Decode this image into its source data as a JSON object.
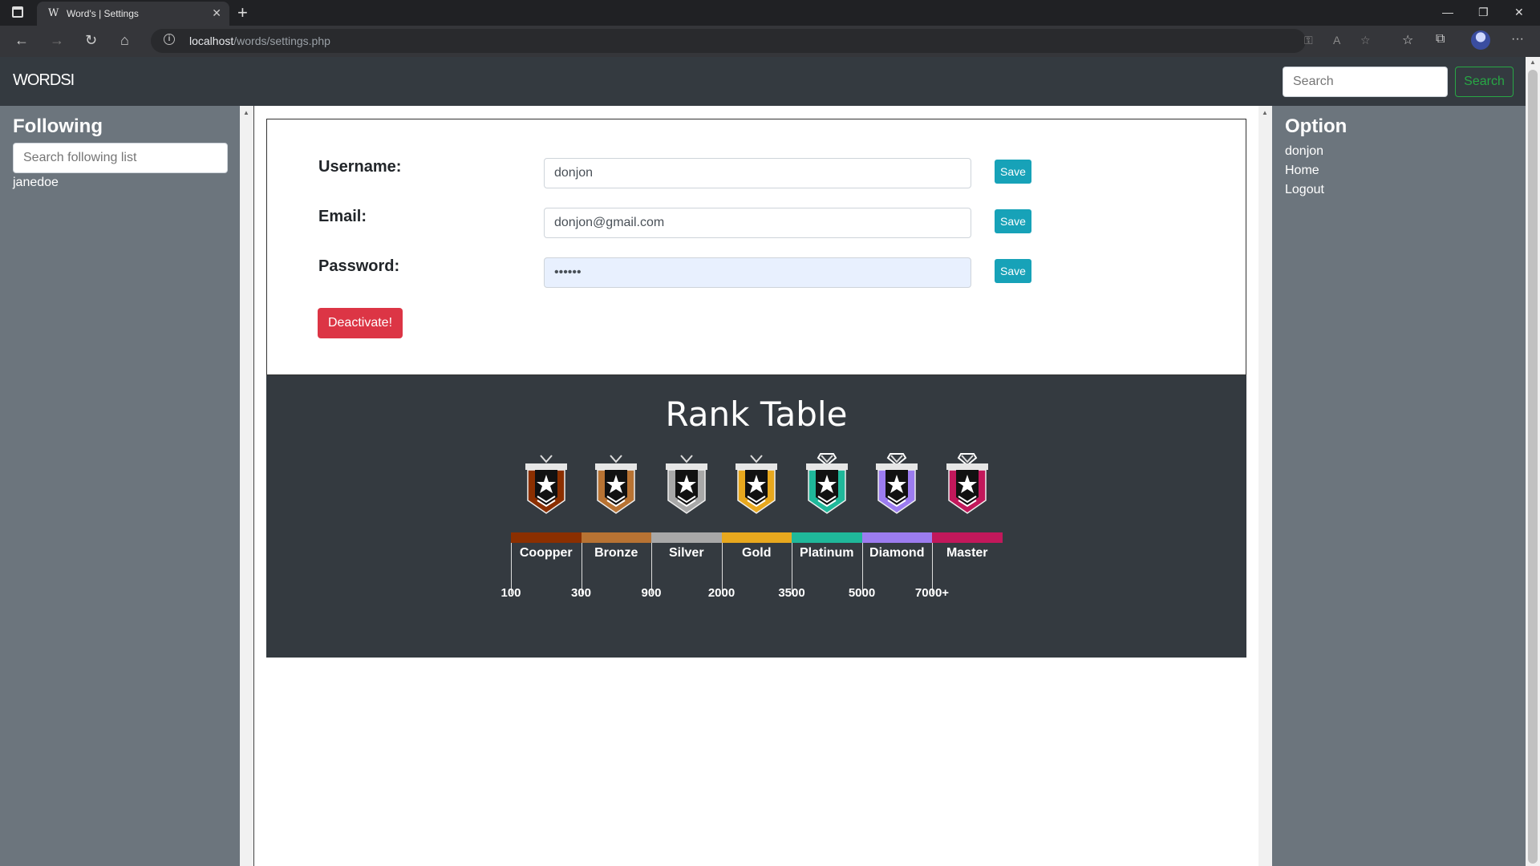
{
  "browser": {
    "tab_favicon": "W",
    "tab_title": "Word's | Settings",
    "url_host": "localhost",
    "url_path": "/words/settings.php"
  },
  "navbar": {
    "brand": "WORDSI",
    "search_placeholder": "Search",
    "search_button": "Search"
  },
  "left_sidebar": {
    "title": "Following",
    "search_placeholder": "Search following list",
    "items": [
      "janedoe"
    ]
  },
  "settings": {
    "username_label": "Username:",
    "username_value": "donjon",
    "email_label": "Email:",
    "email_value": "donjon@gmail.com",
    "password_label": "Password:",
    "password_value": "••••••",
    "save_label": "Save",
    "deactivate_label": "Deactivate!"
  },
  "rank_table": {
    "title": "Rank Table",
    "ranks": [
      {
        "name": "Coopper",
        "color": "#8b2f00"
      },
      {
        "name": "Bronze",
        "color": "#b87333"
      },
      {
        "name": "Silver",
        "color": "#a8a8a8"
      },
      {
        "name": "Gold",
        "color": "#e8a81e"
      },
      {
        "name": "Platinum",
        "color": "#1fb89a"
      },
      {
        "name": "Diamond",
        "color": "#9c7cf0"
      },
      {
        "name": "Master",
        "color": "#c2185b"
      }
    ],
    "thresholds": [
      "100",
      "300",
      "900",
      "2000",
      "3500",
      "5000",
      "7000+"
    ]
  },
  "right_sidebar": {
    "title": "Option",
    "items": [
      "donjon",
      "Home",
      "Logout"
    ]
  },
  "colors": {
    "save": "#17a2b8",
    "deactivate": "#dc3545",
    "navbar": "#343a40",
    "sidebar": "#6c757d",
    "search_outline": "#28a745"
  }
}
